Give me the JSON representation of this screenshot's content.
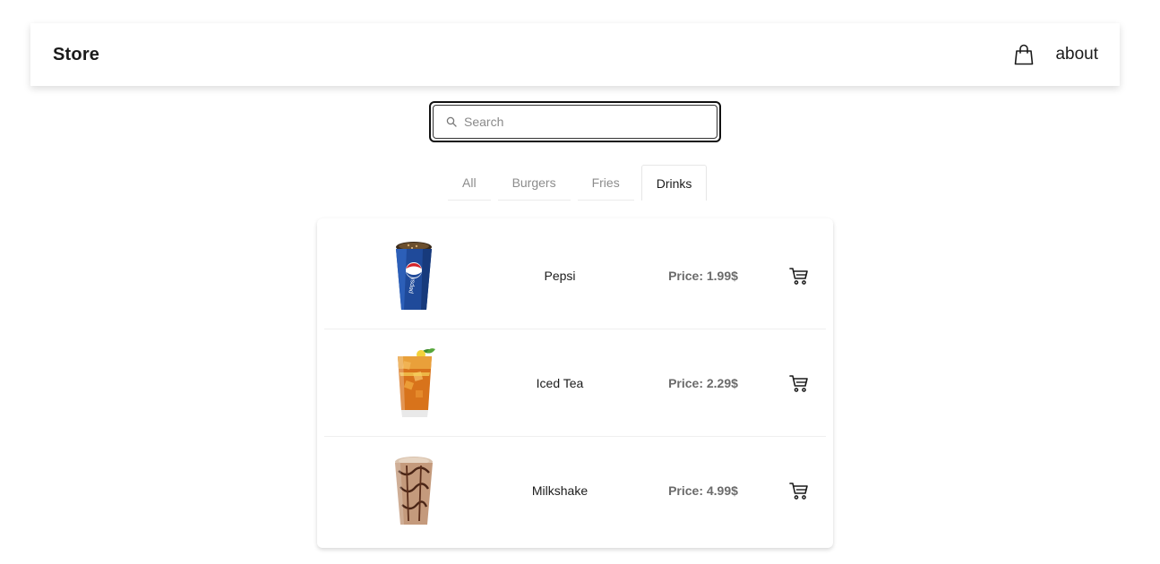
{
  "navbar": {
    "brand": "Store",
    "bag_icon": "shopping-bag-icon",
    "about_label": "about"
  },
  "search": {
    "placeholder": "Search",
    "value": "",
    "icon": "search-icon"
  },
  "tabs": [
    {
      "label": "All",
      "active": false
    },
    {
      "label": "Burgers",
      "active": false
    },
    {
      "label": "Fries",
      "active": false
    },
    {
      "label": "Drinks",
      "active": true
    }
  ],
  "products": [
    {
      "name": "Pepsi",
      "price": "Price: 1.99$",
      "image": "pepsi-cup-image",
      "cart_icon": "cart-icon"
    },
    {
      "name": "Iced Tea",
      "price": "Price: 2.29$",
      "image": "iced-tea-glass-image",
      "cart_icon": "cart-icon"
    },
    {
      "name": "Milkshake",
      "price": "Price: 4.99$",
      "image": "milkshake-cup-image",
      "cart_icon": "cart-icon"
    }
  ],
  "colors": {
    "text": "#1b1b1b",
    "muted": "#8c8c8c",
    "price": "#6b6b6b",
    "pepsi_blue": "#1f4a9a"
  }
}
